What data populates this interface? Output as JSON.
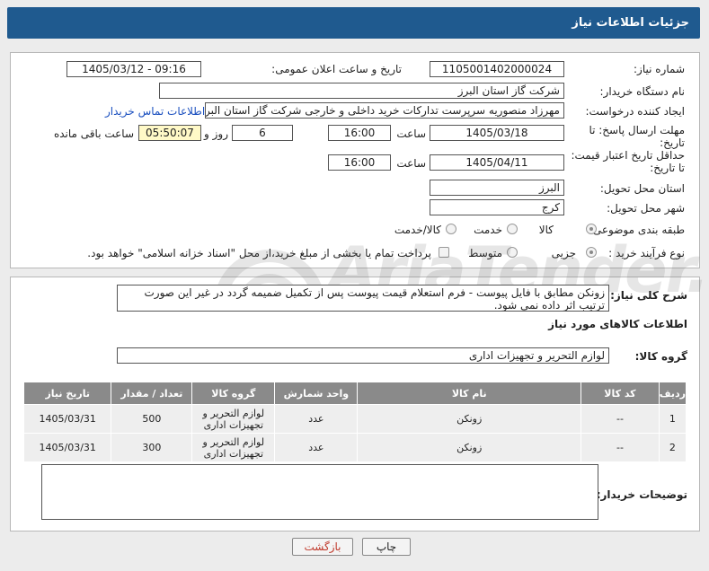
{
  "page": {
    "title": "جزئیات اطلاعات نیاز"
  },
  "need": {
    "number_label": "شماره نیاز:",
    "number": "1105001402000024",
    "announce_label": "تاریخ و ساعت اعلان عمومی:",
    "announce_value": "1405/03/12 - 09:16",
    "buyer_label": "نام دستگاه خریدار:",
    "buyer": "شرکت گاز استان البرز",
    "creator_label": "ایجاد کننده درخواست:",
    "creator": "مهرزاد منصوریه سرپرست تدارکات خرید داخلی و خارجی شرکت گاز استان البرز",
    "contact_link": "اطلاعات تماس خریدار",
    "deadline_label_1": "مهلت ارسال پاسخ: تا",
    "deadline_label_2": "تاریخ:",
    "deadline_date": "1405/03/18",
    "time_word": "ساعت",
    "deadline_time": "16:00",
    "days": "6",
    "days_word": "روز و",
    "remaining_time": "05:50:07",
    "remaining_word": "ساعت باقی مانده",
    "validity_label_1": "حداقل تاریخ اعتبار قیمت:",
    "validity_label_2": "تا تاریخ:",
    "validity_date": "1405/04/11",
    "validity_time": "16:00",
    "province_label": "استان محل تحویل:",
    "province": "البرز",
    "city_label": "شهر محل تحویل:",
    "city": "کرج",
    "category_label": "طبقه بندی موضوعی:",
    "category_options": [
      "کالا",
      "خدمت",
      "کالا/خدمت"
    ],
    "category_selected": "کالا",
    "process_label": "نوع فرآیند خرید :",
    "process_options": [
      "جزیی",
      "متوسط"
    ],
    "payment_note": "پرداخت تمام یا بخشی از مبلغ خرید،از محل \"اسناد خزانه اسلامی\" خواهد بود."
  },
  "description": {
    "label": "شرح کلی نیاز:",
    "text": "زونکن مطابق با فایل پیوست - فرم استعلام قیمت پیوست پس از تکمیل ضمیمه گردد در غیر این صورت ترتیب اثر داده نمی شود."
  },
  "goods": {
    "section_title": "اطلاعات کالاهای مورد نیاز",
    "group_label": "گروه کالا:",
    "group_value": "لوازم التحریر و تجهیزات اداری",
    "columns": [
      "ردیف",
      "کد کالا",
      "نام کالا",
      "واحد شمارش",
      "گروه کالا",
      "تعداد / مقدار",
      "تاریخ نیاز"
    ],
    "rows": [
      {
        "row": "1",
        "code": "--",
        "name": "زونکن",
        "unit": "عدد",
        "group": "لوازم التحریر و تجهیزات اداری",
        "qty": "500",
        "date": "1405/03/31"
      },
      {
        "row": "2",
        "code": "--",
        "name": "زونکن",
        "unit": "عدد",
        "group": "لوازم التحریر و تجهیزات اداری",
        "qty": "300",
        "date": "1405/03/31"
      }
    ]
  },
  "buyer_notes": {
    "label": "توضیحات خریدار:",
    "text": ""
  },
  "buttons": {
    "print": "چاپ",
    "back": "بازگشت"
  },
  "watermark": {
    "text": "AriaTender.net"
  },
  "colors": {
    "titlebar": "#1f5a8f",
    "table_header": "#8a8a8a",
    "link": "#1a4fbf",
    "highlight": "#fff9c7"
  }
}
